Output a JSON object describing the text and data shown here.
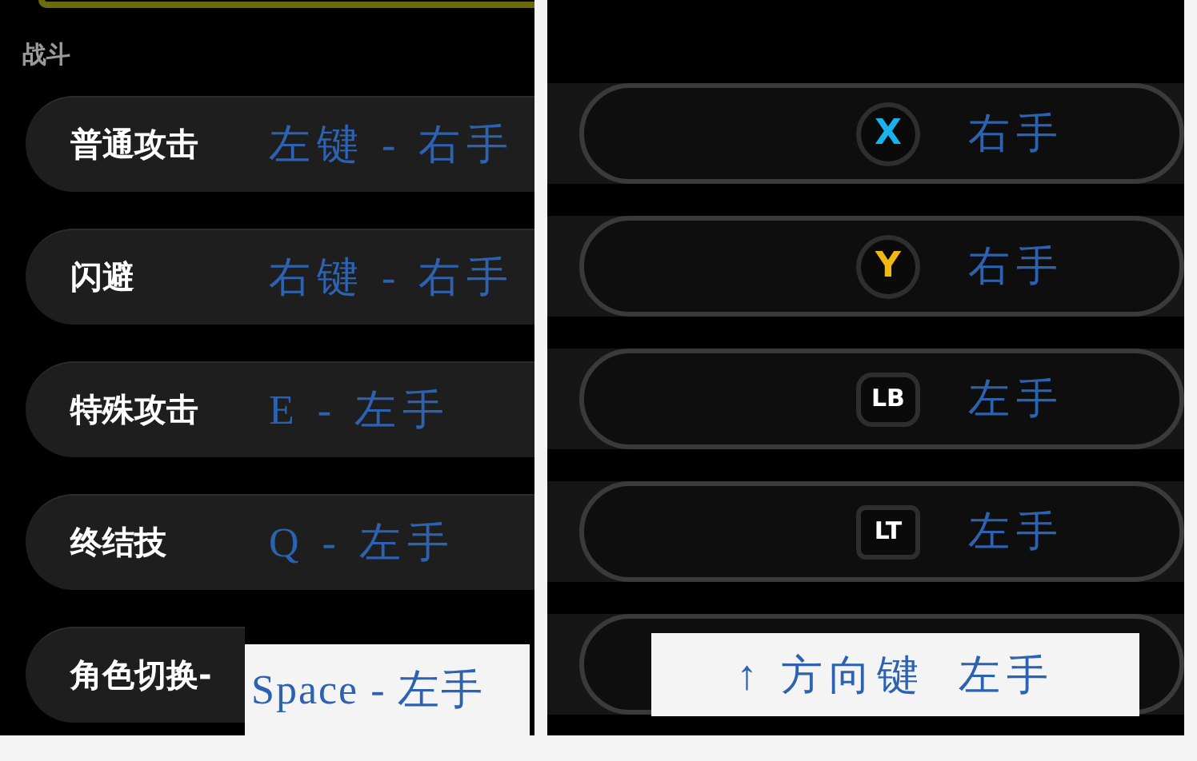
{
  "left_panel": {
    "section_title": "战斗",
    "rows": [
      {
        "label": "普通攻击",
        "annotation": "左键 - 右手",
        "boxed": false
      },
      {
        "label": "闪避",
        "annotation": "右键 - 右手",
        "boxed": false
      },
      {
        "label": "特殊攻击",
        "annotation": "E - 左手",
        "boxed": false
      },
      {
        "label": "终结技",
        "annotation": "Q - 左手",
        "boxed": false
      },
      {
        "label": "角色切换-",
        "annotation": "Space - 左手",
        "boxed": true
      }
    ]
  },
  "right_panel": {
    "rows": [
      {
        "button": {
          "text": "X",
          "kind": "round",
          "color": "#1ab2ea"
        },
        "annotation": "右手",
        "boxed": false
      },
      {
        "button": {
          "text": "Y",
          "kind": "round",
          "color": "#f0b814"
        },
        "annotation": "右手",
        "boxed": false
      },
      {
        "button": {
          "text": "LB",
          "kind": "bumper",
          "color": "#ffffff"
        },
        "annotation": "左手",
        "boxed": false
      },
      {
        "button": {
          "text": "LT",
          "kind": "trigger",
          "color": "#ffffff"
        },
        "annotation": "左手",
        "boxed": false
      },
      {
        "annotation": "↑ 方向键  左手",
        "boxed": true
      }
    ]
  }
}
